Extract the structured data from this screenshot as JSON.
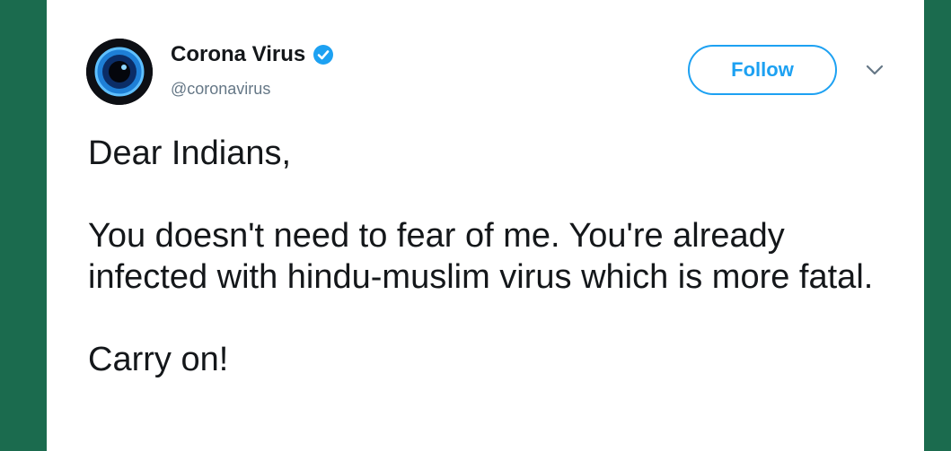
{
  "tweet": {
    "author": {
      "name": "Corona Virus",
      "handle": "@coronavirus",
      "verified": true,
      "avatar_icon": "virus-eye-icon"
    },
    "follow_label": "Follow",
    "menu_icon": "chevron-down-icon",
    "greeting": "Dear Indians,",
    "body": "You doesn't need to fear of me. You're already infected with hindu-muslim virus which is more fatal.",
    "closing": "Carry on!"
  },
  "colors": {
    "frame_background": "#1b6b4e",
    "card_background": "#ffffff",
    "accent": "#1da1f2",
    "text": "#14171a",
    "muted_text": "#657786"
  }
}
